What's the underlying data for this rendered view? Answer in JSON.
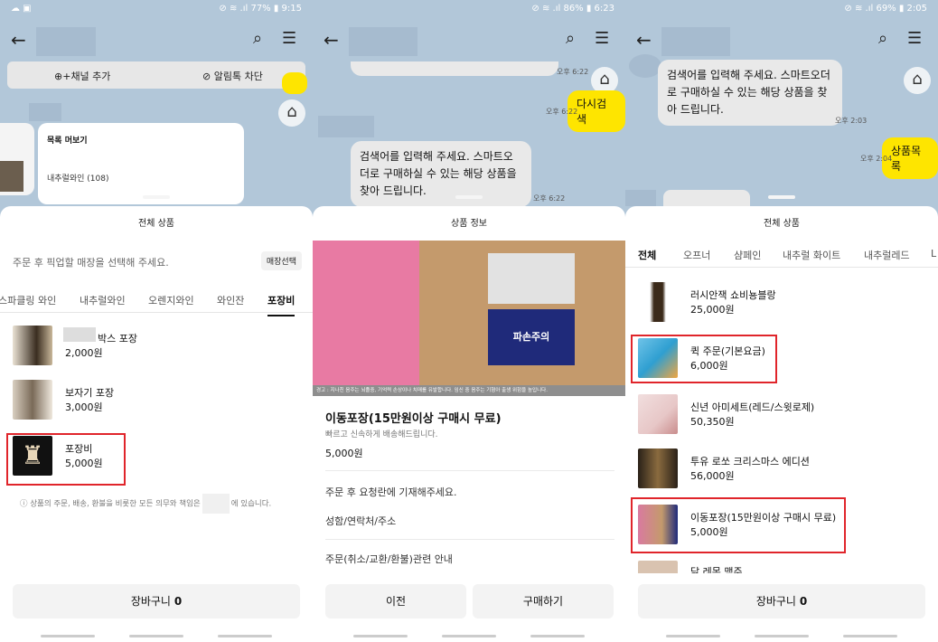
{
  "panels": [
    {
      "status": {
        "left": "☁ ▣",
        "right": "⊘ ≋ .ıl 77% ▮ 9:15"
      },
      "chat_header": {
        "add_channel": "채널 추가",
        "block": "알림톡 차단"
      },
      "chat_card": {
        "title": "목록 머보기",
        "item": "내추럴와인 (108)"
      },
      "sheet_title": "전체 상품",
      "pickup_text": "주문 후 픽업할 매장을 선택해 주세요.",
      "pickup_button": "매장선택",
      "tabs": [
        "스파클링 와인",
        "내추럴와인",
        "오렌지와인",
        "와인잔",
        "포장비"
      ],
      "items": [
        {
          "name": "박스 포장",
          "price": "2,000원"
        },
        {
          "name": "보자기 포장",
          "price": "3,000원"
        },
        {
          "name": "포장비",
          "price": "5,000원"
        }
      ],
      "notice": "상품의 주문, 배송, 환불을 비롯한 모든 의무와 책임은",
      "notice_end": "에 있습니다.",
      "cart": "장바구니",
      "cart_count": "0"
    },
    {
      "status": {
        "left": "",
        "right": "⊘ ≋ .ıl 86% ▮ 6:23"
      },
      "chat": {
        "time1": "오후 6:22",
        "search_again": "다시검색",
        "time2": "오후 6:22",
        "bubble": "검색어를 입력해 주세요. 스마트오더로 구매하실 수 있는 해당 상품을 찾아 드립니다.",
        "time3": "오후 6:22"
      },
      "sheet_title": "상품 정보",
      "banner": {
        "label": "파손주의",
        "caution": "경고 : 지나친 음주는 뇌졸중, 기억력 손상이나 치매를 유발합니다. 임신 중 음주는 기형아 출생 위험을 높입니다."
      },
      "product": {
        "title": "이동포장(15만원이상 구매시 무료)",
        "subtitle": "빠르고 신속하게 배송해드립니다.",
        "price": "5,000원"
      },
      "rows": [
        "주문 후 요청란에 기재해주세요.",
        "성함/연락처/주소",
        "주문(취소/교환/환불)관련 안내"
      ],
      "prev": "이전",
      "buy": "구매하기"
    },
    {
      "status": {
        "left": "",
        "right": "⊘ ≋ .ıl 69% ▮ 2:05"
      },
      "chat": {
        "bubble": "검색어를 입력해 주세요. 스마트오더로 구매하실 수 있는 해당 상품을 찾아 드립니다.",
        "time1": "오후 2:03",
        "product_list": "상품목록",
        "time2": "오후 2:04"
      },
      "sheet_title": "전체 상품",
      "tabs": [
        "전체",
        "오프너",
        "샴페인",
        "내추럴 화이트",
        "내추럴레드",
        "L"
      ],
      "items": [
        {
          "name": "러시안잭 쇼비뇽블랑",
          "price": "25,000원"
        },
        {
          "name": "퀵 주문(기본요금)",
          "price": "6,000원"
        },
        {
          "name": "신년 아미세트(레드/스윗로제)",
          "price": "50,350원"
        },
        {
          "name": "투유 로쏘 크리스마스 에디션",
          "price": "56,000원"
        },
        {
          "name": "이동포장(15만원이상 구매시 무료)",
          "price": "5,000원"
        },
        {
          "name": "닭 레몬 맥주",
          "price": ""
        }
      ],
      "cart": "장바구니",
      "cart_count": "0"
    }
  ]
}
